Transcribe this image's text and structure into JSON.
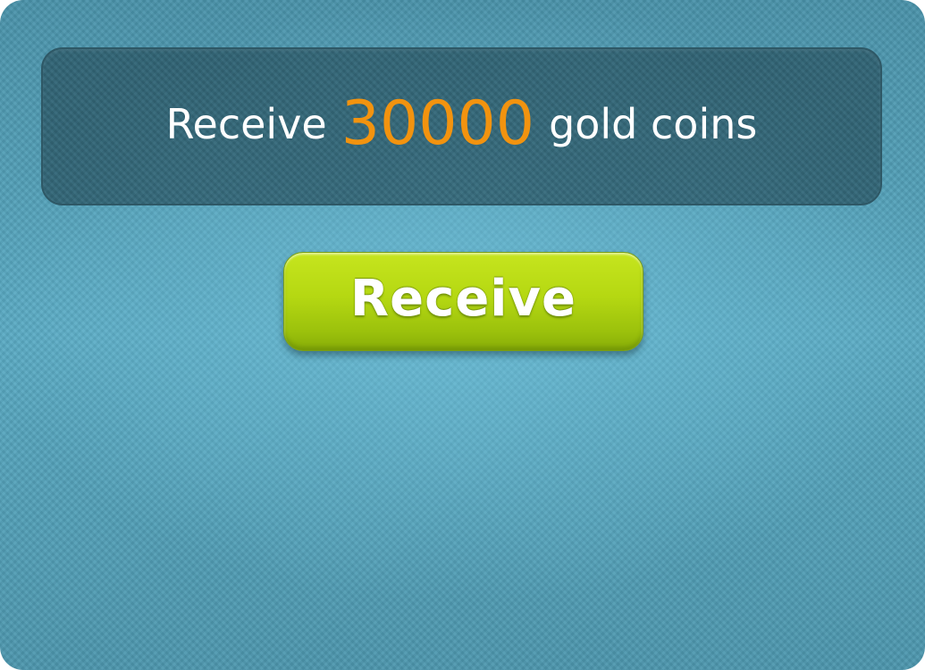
{
  "banner": {
    "prefix": "Receive",
    "amount": "30000",
    "suffix": "gold coins"
  },
  "button": {
    "label": "Receive"
  },
  "colors": {
    "amount": "#f2930f",
    "button": "#b5d812",
    "background": "#4f9db4"
  }
}
